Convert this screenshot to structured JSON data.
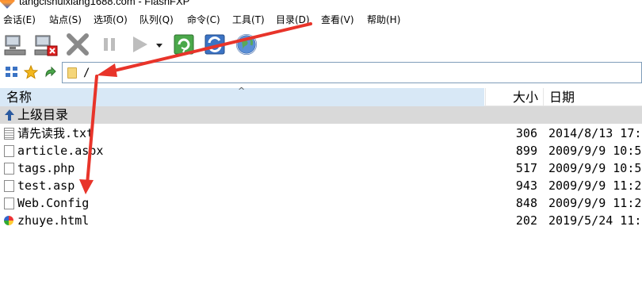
{
  "window": {
    "title": "tangcishuixiang1688.com - FlashFXP"
  },
  "menu": [
    {
      "label": "会话(E)"
    },
    {
      "label": "站点(S)"
    },
    {
      "label": "选项(O)"
    },
    {
      "label": "队列(Q)"
    },
    {
      "label": "命令(C)"
    },
    {
      "label": "工具(T)"
    },
    {
      "label": "目录(D)"
    },
    {
      "label": "查看(V)"
    },
    {
      "label": "帮助(H)"
    }
  ],
  "toolbar": {
    "buttons": [
      "connect-icon",
      "disconnect-icon",
      "abort-icon",
      "pause-icon",
      "transfer-queue-icon",
      "dropdown-arrow-icon",
      "refresh-icon",
      "sync-browse-icon",
      "globe-icon"
    ]
  },
  "address": {
    "path": "/"
  },
  "columns": {
    "name": "名称",
    "size": "大小",
    "date": "日期"
  },
  "parent_dir": {
    "label": "上级目录"
  },
  "files": [
    {
      "name": "请先读我.txt",
      "size": "306",
      "date": "2014/8/13 17:",
      "icon": "text-file-icon"
    },
    {
      "name": "article.aspx",
      "size": "899",
      "date": "2009/9/9 10:5",
      "icon": "file-icon"
    },
    {
      "name": "tags.php",
      "size": "517",
      "date": "2009/9/9 10:5",
      "icon": "file-icon"
    },
    {
      "name": "test.asp",
      "size": "943",
      "date": "2009/9/9 11:2",
      "icon": "file-icon"
    },
    {
      "name": "Web.Config",
      "size": "848",
      "date": "2009/9/9 11:2",
      "icon": "file-icon"
    },
    {
      "name": "zhuye.html",
      "size": "202",
      "date": "2019/5/24 11:",
      "icon": "html-file-icon"
    }
  ],
  "annotation_color": "#e8342a"
}
